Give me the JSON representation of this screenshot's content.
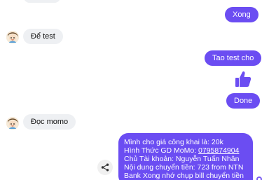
{
  "messages": {
    "sent_xong": "Xong",
    "recv_de_test": "Để test",
    "sent_tao_test": "Tao test cho",
    "sent_done": "Done",
    "recv_doc_momo": "Đọc momo",
    "long_lines": [
      "Mình cho giá công khai là: 20k",
      "Hình Thức GD MoMo: 0795874904",
      "Chủ Tài khoản: Nguyễn Tuấn Nhân",
      "Nội dung chuyển tiền: 723 from NTN",
      "Bank Xong nhớ chụp bill chuyển tiền"
    ],
    "phone_number": "0795874904"
  },
  "icons": {
    "like": "thumbs-up-icon",
    "share": "share-icon",
    "avatar": "avatar-icon"
  },
  "colors": {
    "sent_bubble": "#6b4df2",
    "received_bubble": "#eef0f3"
  }
}
